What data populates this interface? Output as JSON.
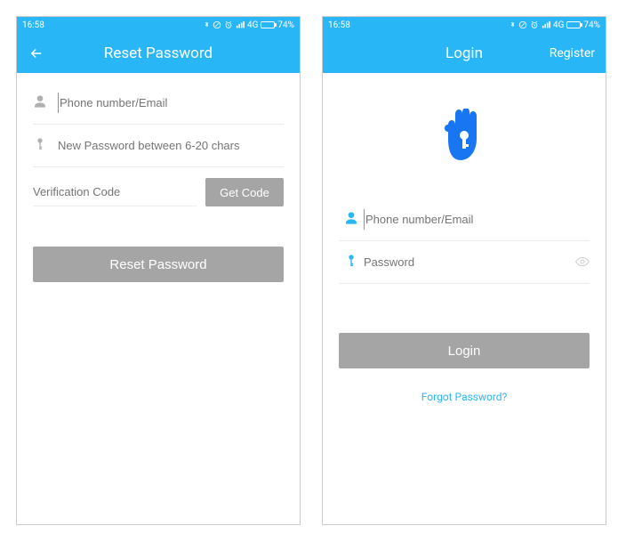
{
  "status": {
    "time": "16:58",
    "net": "4G",
    "battery": "74%"
  },
  "reset": {
    "title": "Reset Password",
    "phone_placeholder": "Phone number/Email",
    "pwd_placeholder": "New Password between 6-20 chars",
    "code_placeholder": "Verification Code",
    "get_code": "Get Code",
    "submit": "Reset Password"
  },
  "login": {
    "title": "Login",
    "register": "Register",
    "phone_placeholder": "Phone number/Email",
    "pwd_placeholder": "Password",
    "submit": "Login",
    "forgot": "Forgot Password?"
  }
}
